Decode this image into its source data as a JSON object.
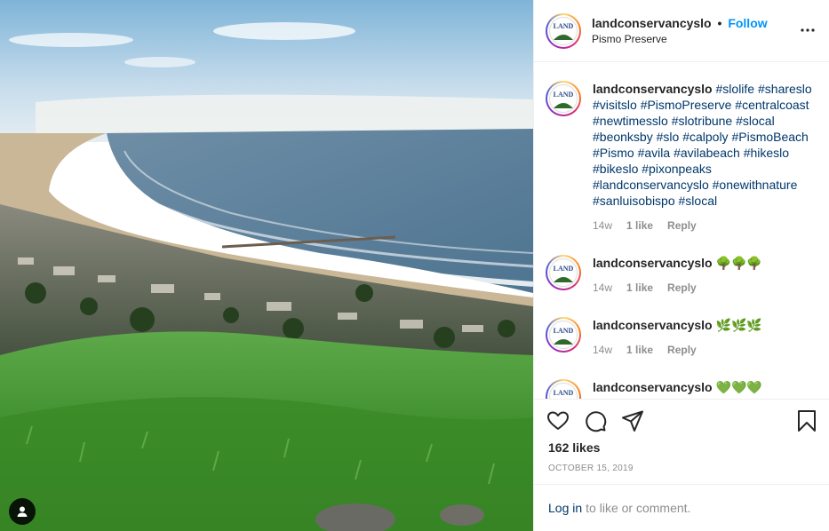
{
  "header": {
    "username": "landconservancyslo",
    "separator": "•",
    "follow_label": "Follow",
    "location": "Pismo Preserve"
  },
  "avatar_logo_text": "LAND",
  "caption": {
    "username": "landconservancyslo",
    "tags": [
      "#slolife",
      "#shareslo",
      "#visitslo",
      "#PismoPreserve",
      "#centralcoast",
      "#newtimesslo",
      "#slotribune",
      "#slocal",
      "#beonksby",
      "#slo",
      "#calpoly",
      "#PismoBeach",
      "#Pismo",
      "#avila",
      "#avilabeach",
      "#hikeslo",
      "#bikeslo",
      "#pixonpeaks",
      "#landconservancyslo",
      "#onewithnature",
      "#sanluisobispo",
      "#slocal"
    ],
    "age": "14w",
    "likes": "1 like",
    "reply": "Reply"
  },
  "comments": [
    {
      "username": "landconservancyslo",
      "text": "🌳🌳🌳",
      "age": "14w",
      "likes": "1 like",
      "reply": "Reply"
    },
    {
      "username": "landconservancyslo",
      "text": "🌿🌿🌿",
      "age": "14w",
      "likes": "1 like",
      "reply": "Reply"
    },
    {
      "username": "landconservancyslo",
      "text": "💚💚💚",
      "age": "",
      "likes": "",
      "reply": ""
    }
  ],
  "actions": {
    "likes_count": "162 likes",
    "date": "OCTOBER 15, 2019"
  },
  "login": {
    "link": "Log in",
    "rest": "to like or comment."
  },
  "icons": [
    "heart-icon",
    "comment-icon",
    "share-icon",
    "bookmark-icon",
    "more-options-icon",
    "user-tag-icon"
  ],
  "colors": {
    "follow": "#0095f6",
    "hashtag": "#00376b",
    "muted": "#8e8e8e",
    "border": "#efefef"
  }
}
